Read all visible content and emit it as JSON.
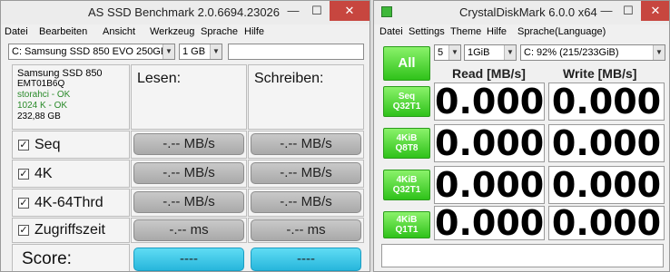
{
  "asssd": {
    "title": "AS SSD Benchmark 2.0.6694.23026",
    "win_minimize": "—",
    "win_maximize": "☐",
    "win_close": "✕",
    "menu": [
      "Datei",
      "Bearbeiten",
      "Ansicht",
      "Werkzeug",
      "Sprache",
      "Hilfe"
    ],
    "drive_select": "C: Samsung SSD 850 EVO 250GB",
    "size_select": "1 GB",
    "drive_info": {
      "model": "Samsung SSD 850",
      "firmware": "EMT01B6Q",
      "driver": "storahci - OK",
      "align": "1024 K - OK",
      "capacity": "232,88 GB"
    },
    "col_read": "Lesen:",
    "col_write": "Schreiben:",
    "rows": [
      {
        "label": "Seq",
        "read": "-.-- MB/s",
        "write": "-.-- MB/s"
      },
      {
        "label": "4K",
        "read": "-.-- MB/s",
        "write": "-.-- MB/s"
      },
      {
        "label": "4K-64Thrd",
        "read": "-.-- MB/s",
        "write": "-.-- MB/s"
      },
      {
        "label": "Zugriffszeit",
        "read": "-.-- ms",
        "write": "-.-- ms"
      }
    ],
    "checkmark": "☑",
    "score_label": "Score:",
    "score_read": "----",
    "score_write": "----"
  },
  "cdm": {
    "title": "CrystalDiskMark 6.0.0 x64",
    "win_minimize": "—",
    "win_maximize": "☐",
    "win_close": "✕",
    "menu": [
      "Datei",
      "Settings",
      "Theme",
      "Hilfe",
      "Sprache(Language)"
    ],
    "count_select": "5",
    "size_select": "1GiB",
    "drive_select": "C: 92% (215/233GiB)",
    "all_button": "All",
    "col_read": "Read [MB/s]",
    "col_write": "Write [MB/s]",
    "tests": [
      {
        "line1": "Seq",
        "line2": "Q32T1",
        "read": "0.000",
        "write": "0.000"
      },
      {
        "line1": "4KiB",
        "line2": "Q8T8",
        "read": "0.000",
        "write": "0.000"
      },
      {
        "line1": "4KiB",
        "line2": "Q32T1",
        "read": "0.000",
        "write": "0.000"
      },
      {
        "line1": "4KiB",
        "line2": "Q1T1",
        "read": "0.000",
        "write": "0.000"
      }
    ],
    "status_text": ""
  },
  "colors": {
    "accent_green": "#2fc21a",
    "score_blue": "#27b6dc",
    "close_red": "#c7463f"
  }
}
